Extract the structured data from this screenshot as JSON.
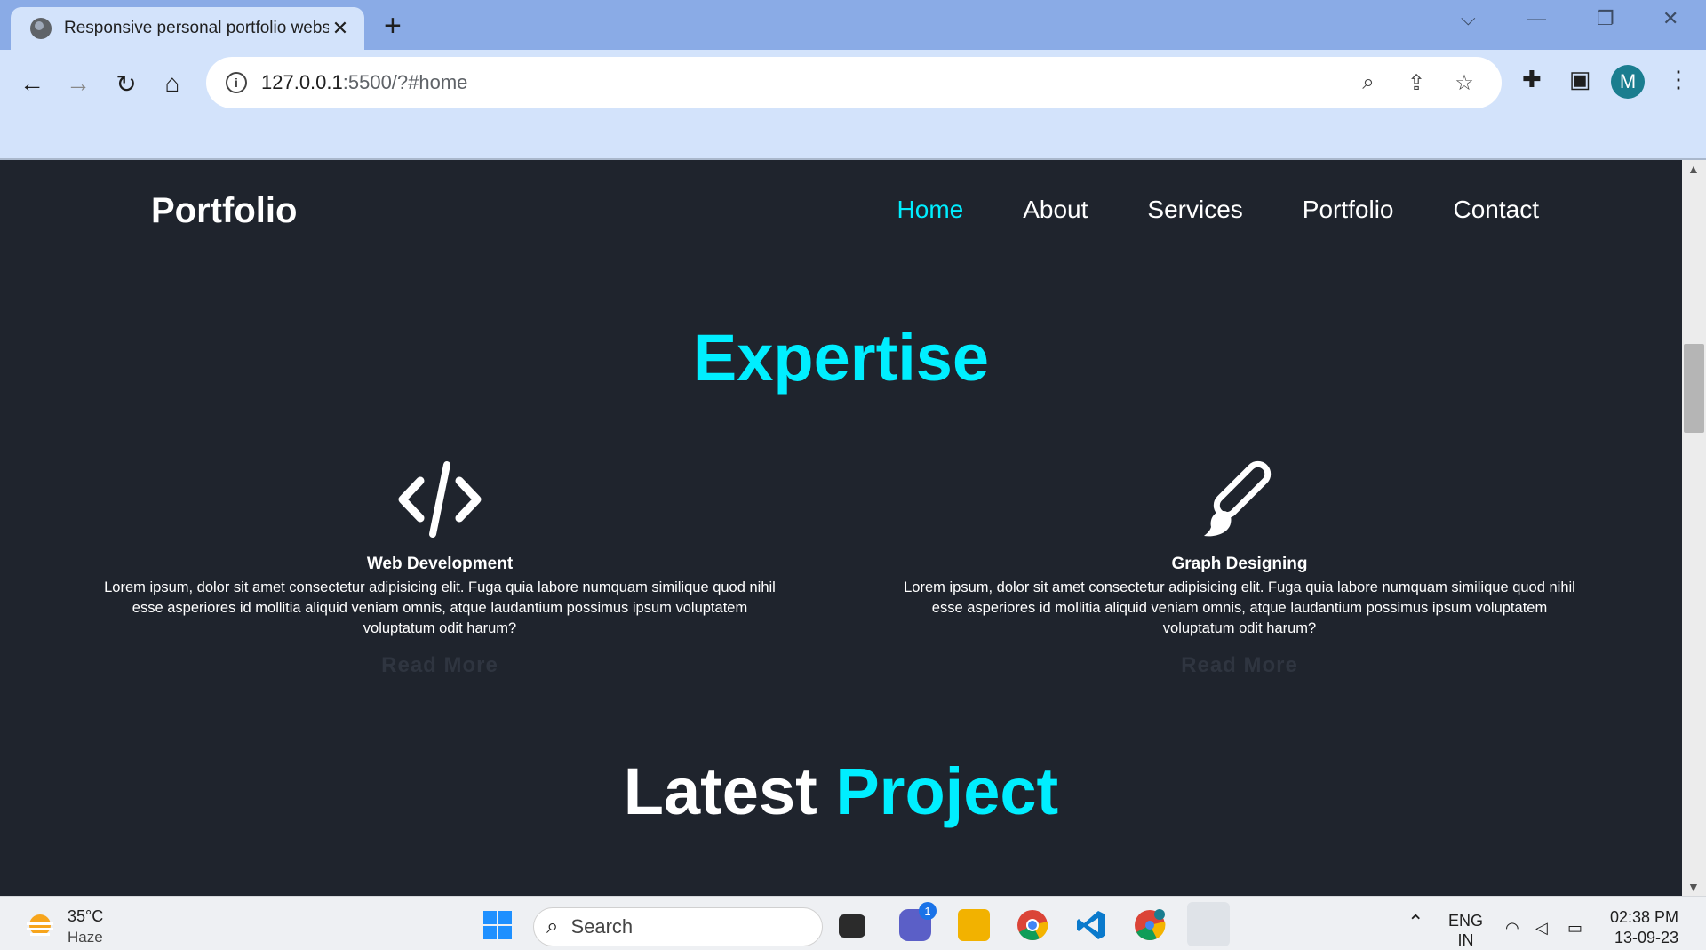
{
  "browser": {
    "tab_title": "Responsive personal portfolio websi",
    "tab_close": "✕",
    "new_tab": "+",
    "url_host": "127.0.0.1",
    "url_rest": ":5500/?#home",
    "profile_initial": "M"
  },
  "site": {
    "logo": "Portfolio",
    "nav": [
      "Home",
      "About",
      "Services",
      "Portfolio",
      "Contact"
    ],
    "active_nav": "Home",
    "expertise_title": "Expertise",
    "cards": [
      {
        "icon": "code-icon",
        "title": "Web Development",
        "text": "Lorem ipsum, dolor sit amet consectetur adipisicing elit. Fuga quia labore numquam similique quod nihil esse asperiores id mollitia aliquid veniam omnis, atque laudantium possimus ipsum voluptatem voluptatum odit harum?",
        "link": "Read More"
      },
      {
        "icon": "paintbrush-icon",
        "title": "Graph Designing",
        "text": "Lorem ipsum, dolor sit amet consectetur adipisicing elit. Fuga quia labore numquam similique quod nihil esse asperiores id mollitia aliquid veniam omnis, atque laudantium possimus ipsum voluptatem voluptatum odit harum?",
        "link": "Read More"
      }
    ],
    "latest_title_white": "Latest",
    "latest_title_accent": "Project"
  },
  "taskbar": {
    "weather_temp": "35°C",
    "weather_desc": "Haze",
    "search_placeholder": "Search",
    "teams_badge": "1",
    "lang_top": "ENG",
    "lang_bottom": "IN",
    "time": "02:38 PM",
    "date": "13-09-23"
  },
  "colors": {
    "accent": "#00eeff",
    "background": "#1f242d"
  }
}
